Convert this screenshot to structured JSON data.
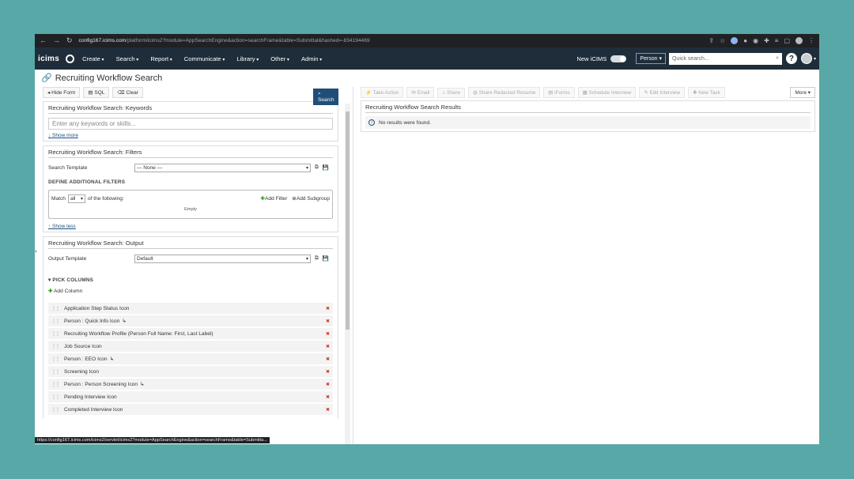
{
  "browser": {
    "url_host": "config167.icims.com",
    "url_path": "/platform/icims2?module=AppSearchEngine&action=searchFrame&table=Submittal&hashed=-834194469"
  },
  "topnav": {
    "logo": "icims",
    "menus": [
      "Create",
      "Search",
      "Report",
      "Communicate",
      "Library",
      "Other",
      "Admin"
    ],
    "new_icims": "New iCIMS",
    "search_type": "Person",
    "quick_search_placeholder": "Quick search...",
    "help": "?"
  },
  "page": {
    "title": "Recruiting Workflow Search"
  },
  "left_toolbar": {
    "hide_form": "Hide Form",
    "sql": "SQL",
    "clear": "Clear",
    "search": "Search"
  },
  "keywords": {
    "header": "Recruiting Workflow Search: Keywords",
    "placeholder": "Enter any keywords or skills...",
    "show_more": "↓ Show more"
  },
  "filters": {
    "header": "Recruiting Workflow Search: Filters",
    "template_label": "Search Template",
    "template_value": "— None —",
    "define_label": "DEFINE ADDITIONAL FILTERS",
    "match_prefix": "Match",
    "match_value": "all",
    "match_suffix": "of the following:",
    "add_filter": "Add Filter",
    "add_subgroup": "Add Subgroup",
    "empty": "Empty",
    "show_less": "↑ Show less"
  },
  "output": {
    "header": "Recruiting Workflow Search: Output",
    "template_label": "Output Template",
    "template_value": "Default",
    "pick_columns": "▾ PICK COLUMNS",
    "add_column": "Add Column",
    "columns": [
      "Application Step Status Icon",
      "Person : Quick Info Icon",
      "Recruiting Workflow Profile (Person Full Name: First, Last Label)",
      "Job Source Icon",
      "Person : EEO Icon",
      "Screening Icon",
      "Person : Person Screening Icon",
      "Pending Interview Icon",
      "Completed Interview Icon"
    ]
  },
  "right_toolbar": {
    "actions": [
      "Take Action",
      "Email",
      "Share",
      "Share Redacted Resume",
      "iForms",
      "Schedule Interview",
      "Edit Interview",
      "New Task"
    ],
    "more": "More"
  },
  "results": {
    "header": "Recruiting Workflow Search Results",
    "message": "No results were found."
  },
  "status_bar_url": "https://config167.icims.com/icims2/servlet/icims2?module=AppSearchEngine&action=searchFrame&table=Submitta..."
}
